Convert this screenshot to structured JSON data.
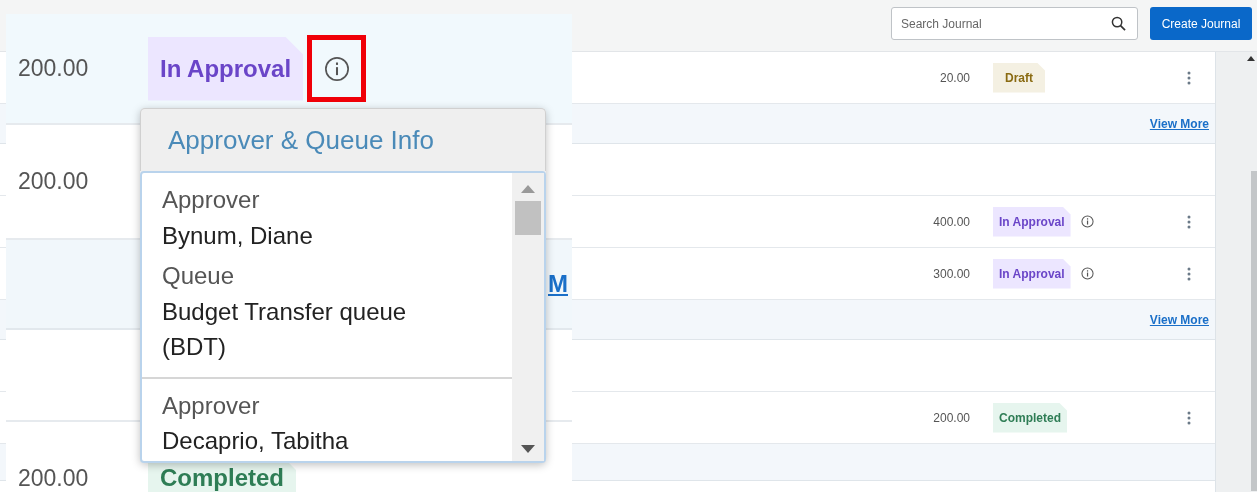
{
  "toolbar": {
    "search": {
      "placeholder": "Search Journal"
    },
    "create_button": "Create Journal"
  },
  "journals": [
    {
      "kind": "item",
      "amount": "20.00",
      "status": {
        "label": "Draft",
        "kind": "draft"
      },
      "info": false
    },
    {
      "kind": "view_more",
      "link": "View More"
    },
    {
      "kind": "blank"
    },
    {
      "kind": "item",
      "amount": "400.00",
      "status": {
        "label": "In Approval",
        "kind": "approval"
      },
      "info": true
    },
    {
      "kind": "item",
      "amount": "300.00",
      "status": {
        "label": "In Approval",
        "kind": "approval"
      },
      "info": true
    },
    {
      "kind": "view_more",
      "link": "View More"
    },
    {
      "kind": "blank"
    },
    {
      "kind": "item",
      "amount": "200.00",
      "status": {
        "label": "Completed",
        "kind": "completed"
      },
      "info": false
    },
    {
      "kind": "band"
    }
  ],
  "inset": {
    "rows": [
      {
        "kind": "item",
        "amount": "200.00",
        "status": {
          "label": "In Approval",
          "kind": "approval"
        },
        "info": true,
        "highlighted": true
      },
      {
        "kind": "item",
        "amount": "200.00"
      },
      {
        "kind": "view_more",
        "link": "M"
      },
      {
        "kind": "blank"
      },
      {
        "kind": "item",
        "amount": "200.00",
        "status": {
          "label": "Completed",
          "kind": "completed"
        },
        "info": false
      }
    ],
    "tooltip": {
      "title": "Approver & Queue Info",
      "entries": [
        {
          "fields": [
            {
              "label": "Approver",
              "value": "Bynum, Diane"
            },
            {
              "label": "Queue",
              "value": "Budget Transfer queue (BDT)"
            }
          ]
        },
        {
          "fields": [
            {
              "label": "Approver",
              "value": "Decaprio, Tabitha"
            }
          ]
        }
      ]
    }
  }
}
